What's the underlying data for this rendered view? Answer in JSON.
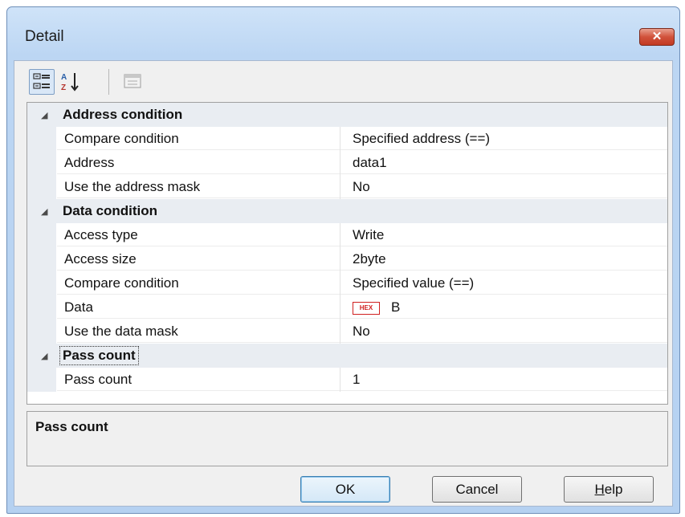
{
  "window": {
    "title": "Detail",
    "close_symbol": "✕"
  },
  "toolbar": {
    "buttons": [
      {
        "icon": "categorized-view-icon"
      },
      {
        "icon": "sort-alphabetical-icon"
      },
      {
        "icon": "property-pages-icon",
        "disabled": true
      }
    ]
  },
  "properties": {
    "address_condition": {
      "label": "Address condition",
      "rows": [
        {
          "name": "Compare condition",
          "value": "Specified address (==)"
        },
        {
          "name": "Address",
          "value": "data1"
        },
        {
          "name": "Use the address mask",
          "value": "No"
        }
      ]
    },
    "data_condition": {
      "label": "Data condition",
      "rows": [
        {
          "name": "Access type",
          "value": "Write"
        },
        {
          "name": "Access size",
          "value": "2byte"
        },
        {
          "name": "Compare condition",
          "value": "Specified value (==)"
        },
        {
          "name": "Data",
          "badge": "HEX",
          "value": "B"
        },
        {
          "name": "Use the data mask",
          "value": "No"
        }
      ]
    },
    "pass_count": {
      "label": "Pass count",
      "rows": [
        {
          "name": "Pass count",
          "value": "1"
        }
      ]
    }
  },
  "description": {
    "title": "Pass count"
  },
  "buttons": {
    "ok": "OK",
    "cancel": "Cancel",
    "help_mnemonic": "H",
    "help_rest": "elp"
  },
  "colors": {
    "hex_badge": "#d02020",
    "category_bg": "#e9edf2"
  }
}
